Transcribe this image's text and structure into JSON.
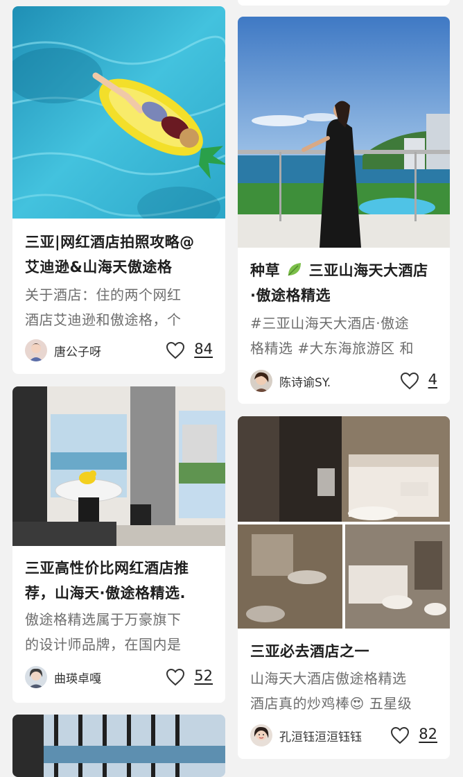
{
  "cards": [
    {
      "title_line1": "三亚|网红酒店拍照攻略@",
      "title_line2": "艾迪逊&山海天傲途格",
      "desc_line1": "关于酒店：住的两个网红",
      "desc_line2": "酒店艾迪逊和傲途格，个",
      "author": "唐公子呀",
      "likes": "84",
      "image": "pool-pineapple-float"
    },
    {
      "title_line1_a": "种草",
      "title_line1_b": "三亚山海天大酒店",
      "title_line2": "·傲途格精选",
      "desc_line1": "#三亚山海天大酒店·傲途",
      "desc_line2": "格精选 #大东海旅游区 和",
      "author": "陈诗谕SY.",
      "likes": "4",
      "image": "woman-on-balcony-sea-view"
    },
    {
      "title_line1": "三亚高性价比网红酒店推",
      "title_line2": "荐，山海天·傲途格精选.",
      "desc_line1": "傲途格精选属于万豪旗下",
      "desc_line2": "的设计师品牌，在国内是",
      "author": "曲瑛卓嘎",
      "likes": "52",
      "image": "bathroom-with-duck-tub"
    },
    {
      "title_line1": "三亚必去酒店之一",
      "desc_line1": "山海天大酒店傲途格精选",
      "desc_line2_a": "酒店真的炒鸡棒",
      "desc_line2_b": "五星级",
      "emoji": "😍",
      "author": "孔洹钰洹洹钰钰",
      "likes": "82",
      "image": "hotel-room-collage"
    }
  ]
}
